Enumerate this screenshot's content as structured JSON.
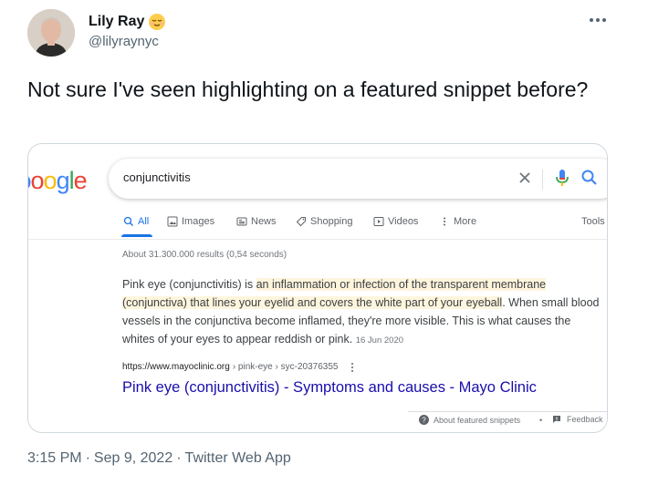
{
  "author": {
    "display_name": "Lily Ray",
    "handle": "@lilyraynyc",
    "emoji_icon": "relieved-face-emoji"
  },
  "tweet": {
    "text": "Not sure I've seen highlighting on a featured snippet before?"
  },
  "footer": {
    "time": "3:15 PM",
    "sep1": "·",
    "date": "Sep 9, 2022",
    "sep2": "·",
    "app": "Twitter Web App"
  },
  "screenshot": {
    "logo_letters": [
      "o",
      "o",
      "g",
      "l",
      "e"
    ],
    "logo_prefix": "ɔ",
    "search_query": "conjunctivitis",
    "tabs": [
      {
        "label": "All",
        "icon": "search-icon"
      },
      {
        "label": "Images",
        "icon": "image-icon"
      },
      {
        "label": "News",
        "icon": "news-icon"
      },
      {
        "label": "Shopping",
        "icon": "tag-icon"
      },
      {
        "label": "Videos",
        "icon": "play-icon"
      },
      {
        "label": "More",
        "icon": "more-vert-icon"
      }
    ],
    "tools_label": "Tools",
    "result_stats": "About 31.300.000 results (0,54 seconds)",
    "snippet": {
      "part1": "Pink eye (conjunctivitis) is ",
      "highlight": "an inflammation or infection of the transparent membrane (conjunctiva) that lines your eyelid and covers the white part of your eyeball",
      "part2": ". When small blood vessels in the conjunctiva become inflamed, they're more visible. This is what causes the whites of your eyes to appear reddish or pink.",
      "date": "16 Jun 2020"
    },
    "source": {
      "domain": "https://www.mayoclinic.org",
      "crumbs": "› pink-eye › syc-20376355"
    },
    "result_title": "Pink eye (conjunctivitis) - Symptoms and causes - Mayo Clinic",
    "about_snippets": "About featured snippets",
    "bullet": "•",
    "feedback": "Feedback"
  },
  "colors": {
    "google_blue": "#4285f4",
    "google_red": "#ea4335",
    "google_yellow": "#fbbc05",
    "google_green": "#34a853",
    "link": "#1a0dab",
    "highlight": "#fef5dd",
    "active_tab": "#1a73e8"
  }
}
